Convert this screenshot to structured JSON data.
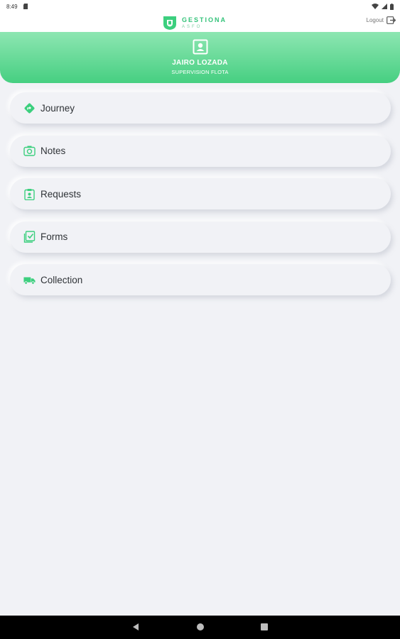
{
  "status_bar": {
    "time": "8:49"
  },
  "header": {
    "brand_name": "GESTIONA",
    "brand_sub": "ASFO",
    "logout_label": "Logout"
  },
  "profile": {
    "name": "JAIRO LOZADA",
    "role": "SUPERVISION FLOTA"
  },
  "menu": {
    "items": [
      {
        "label": "Journey",
        "icon": "route-sign-icon"
      },
      {
        "label": "Notes",
        "icon": "camera-icon"
      },
      {
        "label": "Requests",
        "icon": "clipboard-user-icon"
      },
      {
        "label": "Forms",
        "icon": "checklist-icon"
      },
      {
        "label": "Collection",
        "icon": "truck-icon"
      }
    ]
  },
  "colors": {
    "accent": "#3ccf7e",
    "banner_top": "#8ee6b2",
    "banner_bottom": "#46cf81",
    "background": "#f1f2f6"
  }
}
